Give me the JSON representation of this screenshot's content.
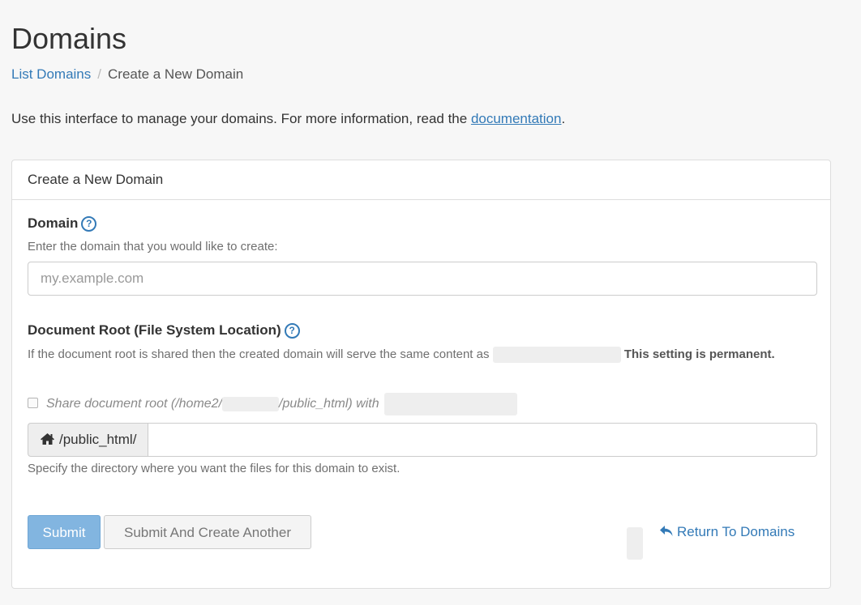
{
  "page": {
    "title": "Domains"
  },
  "breadcrumb": {
    "link_label": "List Domains",
    "separator": "/",
    "current": "Create a New Domain"
  },
  "intro": {
    "text": "Use this interface to manage your domains. For more information, read the ",
    "link_label": "documentation",
    "suffix": "."
  },
  "panel": {
    "heading": "Create a New Domain",
    "domain_field": {
      "label": "Domain",
      "help_text": "Enter the domain that you would like to create:",
      "placeholder": "my.example.com",
      "value": ""
    },
    "docroot_field": {
      "label": "Document Root (File System Location)",
      "help_text_before": "If the document root is shared then the created domain will serve the same content as",
      "help_text_bold": "This setting is permanent.",
      "share_checkbox_prefix": "Share document root (/home2/",
      "share_checkbox_middle": "/public_html) with",
      "share_checked": false,
      "prefix_label": "/public_html/",
      "value": "",
      "footer_help": "Specify the directory where you want the files for this domain to exist."
    },
    "actions": {
      "submit": "Submit",
      "submit_another": "Submit And Create Another",
      "return": "Return To Domains"
    }
  },
  "icons": {
    "help": "question-circle-icon",
    "home": "home-icon",
    "return": "reply-icon"
  },
  "colors": {
    "link": "#337ab7",
    "primary_button": "#82b5e0",
    "background": "#f7f7f7"
  }
}
